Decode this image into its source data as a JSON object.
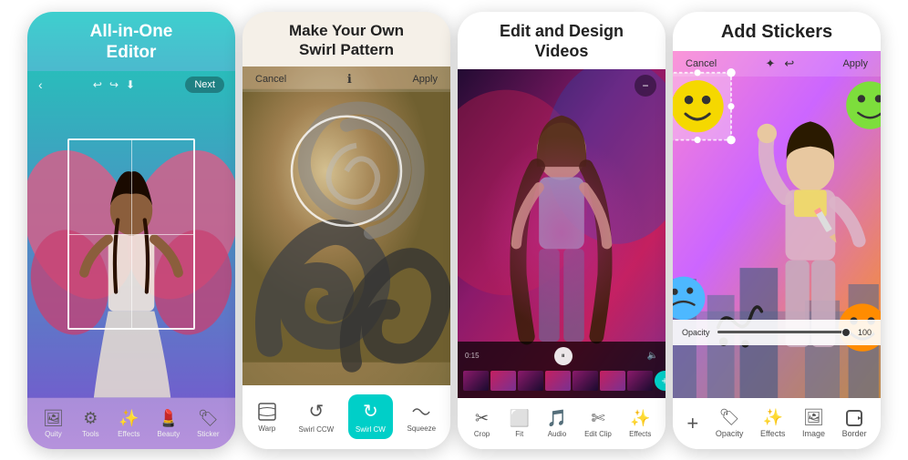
{
  "cards": [
    {
      "id": "card1",
      "title": "All-in-One\nEditor",
      "title_display": "All-in-One Editor",
      "topbar": {
        "back": "<",
        "buttons": [
          "↩",
          "↪",
          "⬇"
        ],
        "next": "Next"
      },
      "bottom_icons": [
        {
          "icon": "🖼",
          "label": "Quity"
        },
        {
          "icon": "⚙",
          "label": "Tools"
        },
        {
          "icon": "✨",
          "label": "Effects"
        },
        {
          "icon": "💄",
          "label": "Beauty"
        },
        {
          "icon": "🏷",
          "label": "Sticker"
        }
      ]
    },
    {
      "id": "card2",
      "title": "Make Your Own\nSwirl Pattern",
      "title_display": "Make Your Own Swirl Pattern",
      "topbar": {
        "cancel": "Cancel",
        "info": "ℹ",
        "apply": "Apply"
      },
      "bottom_icons": [
        {
          "icon": "≋",
          "label": "Warp"
        },
        {
          "icon": "↺",
          "label": "Swirl CCW"
        },
        {
          "icon": "↻",
          "label": "Swirl CW",
          "active": true
        },
        {
          "icon": "⊞",
          "label": "Squeeze"
        }
      ]
    },
    {
      "id": "card3",
      "title": "Edit and Design\nVideos",
      "title_display": "Edit and Design Videos",
      "topbar": {
        "minus": "−"
      },
      "video_time": "0:15",
      "bottom_icons": [
        {
          "icon": "✂",
          "label": "Crop"
        },
        {
          "icon": "⬜",
          "label": "Fit"
        },
        {
          "icon": "🎵",
          "label": "Audio"
        },
        {
          "icon": "✄",
          "label": "Edit Clip"
        },
        {
          "icon": "✨",
          "label": "Effects"
        }
      ]
    },
    {
      "id": "card4",
      "title": "Add Stickers",
      "title_display": "Add Stickers",
      "topbar": {
        "cancel": "Cancel",
        "icons": [
          "✦",
          "↩"
        ],
        "apply": "Apply"
      },
      "opacity": {
        "label": "Opacity",
        "value": "100"
      },
      "bottom_icons": [
        {
          "icon": "+",
          "label": ""
        },
        {
          "icon": "🏷",
          "label": "Opacity"
        },
        {
          "icon": "✨",
          "label": "Effects"
        },
        {
          "icon": "🖼",
          "label": "Image"
        },
        {
          "icon": "▶",
          "label": "Border"
        }
      ]
    }
  ]
}
